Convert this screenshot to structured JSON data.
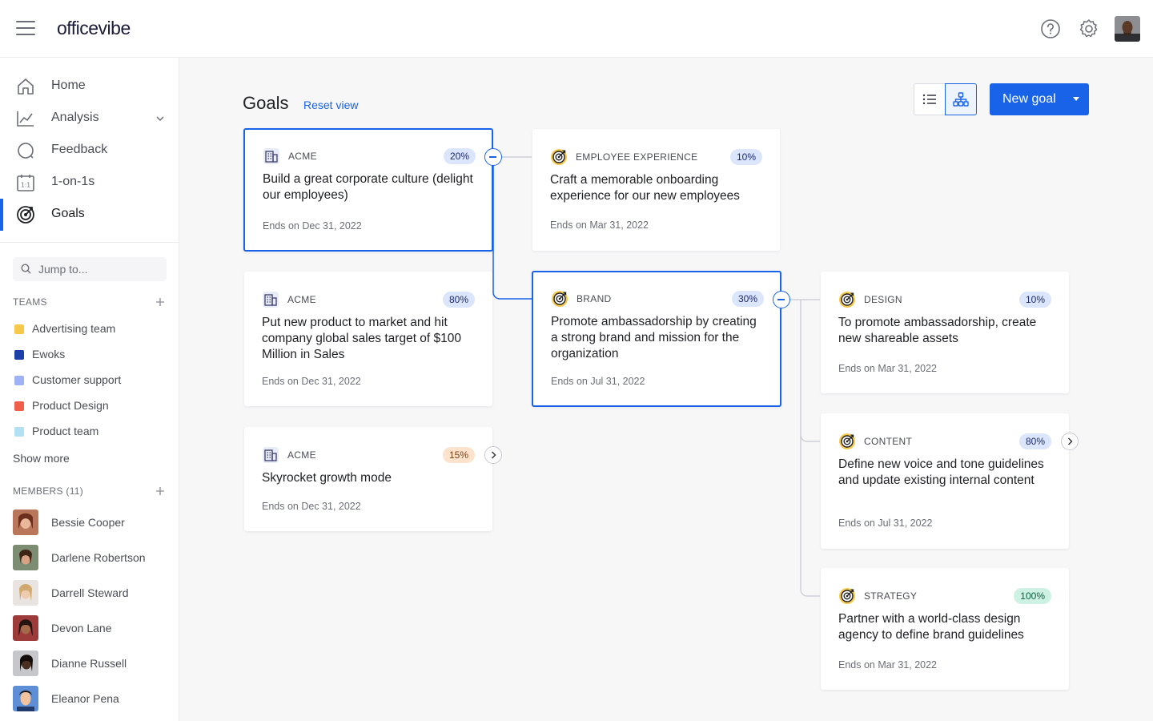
{
  "app": {
    "logo": "officevibe"
  },
  "sidebar": {
    "nav": [
      {
        "label": "Home",
        "icon": "home-icon"
      },
      {
        "label": "Analysis",
        "icon": "analysis-icon"
      },
      {
        "label": "Feedback",
        "icon": "feedback-icon"
      },
      {
        "label": "1-on-1s",
        "icon": "one-on-one-icon"
      },
      {
        "label": "Goals",
        "icon": "goals-icon",
        "active": true
      }
    ],
    "search_placeholder": "Jump to...",
    "teams_title": "TEAMS",
    "teams": [
      {
        "name": "Advertising team",
        "color": "#f6c94c"
      },
      {
        "name": "Ewoks",
        "color": "#1d3fa8"
      },
      {
        "name": "Customer support",
        "color": "#9fb2f5"
      },
      {
        "name": "Product Design",
        "color": "#ef5f4c"
      },
      {
        "name": "Product team",
        "color": "#b3e0f2"
      }
    ],
    "show_more": "Show more",
    "members_title": "MEMBERS (11)",
    "members": [
      {
        "name": "Bessie Cooper"
      },
      {
        "name": "Darlene Robertson"
      },
      {
        "name": "Darrell Steward"
      },
      {
        "name": "Devon Lane"
      },
      {
        "name": "Dianne Russell"
      },
      {
        "name": "Eleanor Pena"
      }
    ]
  },
  "main": {
    "title": "Goals",
    "reset_view": "Reset view",
    "new_goal": "New goal",
    "accent": "#1863e8"
  },
  "goals": [
    {
      "team": "ACME",
      "percent": "20%",
      "title": "Build a great corporate culture (delight our employees)",
      "ends": "Ends on Dec 31, 2022"
    },
    {
      "team": "ACME",
      "percent": "80%",
      "title": "Put new product to market and hit company global sales target of $100 Million in Sales",
      "ends": "Ends on Dec 31, 2022"
    },
    {
      "team": "ACME",
      "percent": "15%",
      "title": "Skyrocket growth mode",
      "ends": "Ends on Dec 31, 2022"
    },
    {
      "team": "EMPLOYEE EXPERIENCE",
      "percent": "10%",
      "title": "Craft a memorable onboarding experience for our new employees",
      "ends": "Ends on Mar 31, 2022"
    },
    {
      "team": "BRAND",
      "percent": "30%",
      "title": "Promote ambassadorship by creating a strong brand and mission for the organization",
      "ends": "Ends on Jul 31, 2022"
    },
    {
      "team": "DESIGN",
      "percent": "10%",
      "title": "To promote ambassadorship, create new shareable assets",
      "ends": "Ends on Mar 31, 2022"
    },
    {
      "team": "CONTENT",
      "percent": "80%",
      "title": "Define new voice and tone guidelines and update existing internal content",
      "ends": "Ends on Jul 31, 2022"
    },
    {
      "team": "STRATEGY",
      "percent": "100%",
      "title": "Partner with a world-class design agency to define brand guidelines",
      "ends": "Ends on Mar 31, 2022"
    }
  ]
}
